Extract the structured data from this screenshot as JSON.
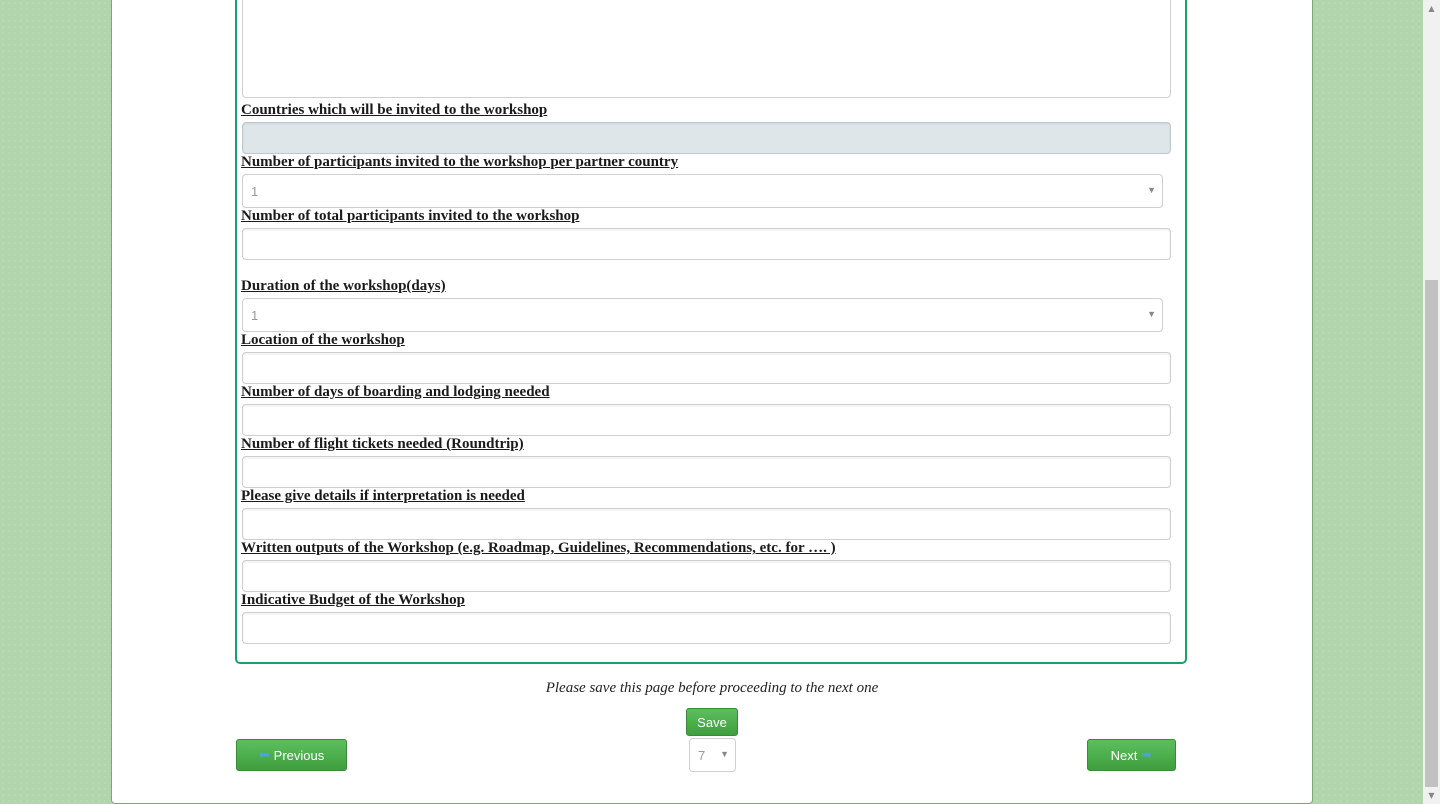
{
  "form": {
    "fields": [
      {
        "label": "Countries which will be invited to the workshop",
        "type": "text",
        "value": ""
      },
      {
        "label": "Number of participants invited to the workshop per partner country",
        "type": "select",
        "value": "1"
      },
      {
        "label": "Number of total participants invited to the workshop",
        "type": "text",
        "value": ""
      },
      {
        "label": "Duration of the workshop(days)",
        "type": "select",
        "value": "1"
      },
      {
        "label": "Location of the workshop",
        "type": "text",
        "value": ""
      },
      {
        "label": "Number of days of boarding and lodging needed",
        "type": "text",
        "value": ""
      },
      {
        "label": "Number of flight tickets needed (Roundtrip)",
        "type": "text",
        "value": ""
      },
      {
        "label": "Please give details if interpretation is needed",
        "type": "text",
        "value": ""
      },
      {
        "label": "Written outputs of the Workshop (e.g. Roadmap, Guidelines, Recommendations, etc. for …. )",
        "type": "text",
        "value": ""
      },
      {
        "label": "Indicative Budget of the Workshop",
        "type": "text",
        "value": ""
      }
    ]
  },
  "footer": {
    "note": "Please save this page before proceeding to the next one",
    "save_label": "Save",
    "previous_label": "Previous",
    "next_label": "Next",
    "page_value": "7"
  },
  "colors": {
    "background": "#b3d5ae",
    "panel_border": "#1aa06a",
    "button": "#4cae4c",
    "arrow_icon": "#4aa3e0"
  }
}
